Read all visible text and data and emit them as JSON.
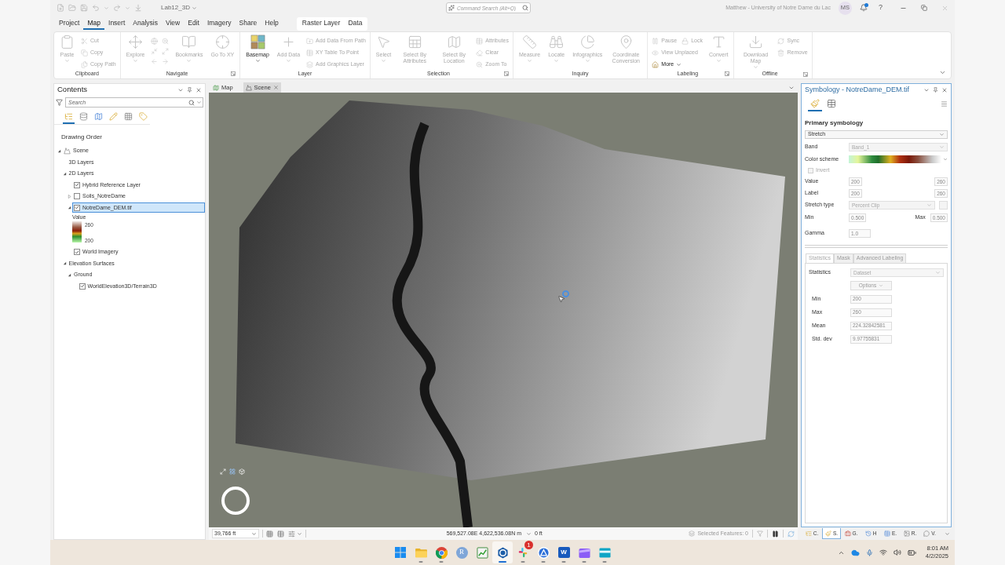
{
  "title_bar": {
    "project": "Lab12_3D",
    "search": {
      "placeholder": "Command Search (Alt+Q)"
    },
    "account": "Matthew - University of Notre Dame du Lac",
    "avatar": "MS",
    "notifications": true,
    "help": "?"
  },
  "menu_tabs": [
    {
      "label": "Project",
      "selected": false
    },
    {
      "label": "Map",
      "selected": true
    },
    {
      "label": "Insert",
      "selected": false
    },
    {
      "label": "Analysis",
      "selected": false
    },
    {
      "label": "View",
      "selected": false
    },
    {
      "label": "Edit",
      "selected": false
    },
    {
      "label": "Imagery",
      "selected": false
    },
    {
      "label": "Share",
      "selected": false
    },
    {
      "label": "Help",
      "selected": false
    }
  ],
  "contextual_tabs": [
    {
      "label": "Raster Layer",
      "selected": false
    },
    {
      "label": "Data",
      "selected": false
    }
  ],
  "ribbon": {
    "groups": [
      {
        "label": "Clipboard",
        "launcher": false,
        "items": [
          {
            "kind": "large",
            "label": "Paste",
            "disabled": true,
            "menu": true
          },
          {
            "kind": "stack",
            "rows": [
              [
                {
                  "label": "Cut",
                  "disabled": true,
                  "menu": false
                }
              ],
              [
                {
                  "label": "Copy",
                  "disabled": true,
                  "menu": false
                }
              ],
              [
                {
                  "label": "Copy Path",
                  "disabled": true,
                  "menu": false
                }
              ]
            ]
          }
        ]
      },
      {
        "label": "Navigate",
        "launcher": true,
        "items": [
          {
            "kind": "large",
            "label": "Explore",
            "disabled": true,
            "menu": true
          },
          {
            "kind": "tools",
            "disabled": true
          },
          {
            "kind": "large",
            "label": "Bookmarks",
            "disabled": true,
            "menu": true
          },
          {
            "kind": "large",
            "label": "Go To XY",
            "disabled": true,
            "menu": false
          }
        ]
      },
      {
        "label": "Layer",
        "launcher": false,
        "items": [
          {
            "kind": "large",
            "label": "Basemap",
            "disabled": false,
            "menu": true
          },
          {
            "kind": "large",
            "label": "Add Data",
            "disabled": true,
            "menu": true
          },
          {
            "kind": "stack",
            "rows": [
              [
                {
                  "label": "Add Data From Path",
                  "disabled": true,
                  "menu": false
                }
              ],
              [
                {
                  "label": "XY Table To Point",
                  "disabled": true,
                  "menu": false
                }
              ],
              [
                {
                  "label": "Add Graphics Layer",
                  "disabled": true,
                  "menu": false
                }
              ]
            ]
          }
        ]
      },
      {
        "label": "Selection",
        "launcher": true,
        "items": [
          {
            "kind": "large",
            "label": "Select",
            "disabled": true,
            "menu": true
          },
          {
            "kind": "large",
            "label": "Select By Attributes",
            "disabled": true,
            "menu": false
          },
          {
            "kind": "large",
            "label": "Select By Location",
            "disabled": true,
            "menu": false
          },
          {
            "kind": "stack",
            "rows": [
              [
                {
                  "label": "Attributes",
                  "disabled": true,
                  "menu": false
                }
              ],
              [
                {
                  "label": "Clear",
                  "disabled": true,
                  "menu": false
                }
              ],
              [
                {
                  "label": "Zoom To",
                  "disabled": true,
                  "menu": false
                }
              ]
            ]
          }
        ]
      },
      {
        "label": "Inquiry",
        "launcher": false,
        "items": [
          {
            "kind": "large",
            "label": "Measure",
            "disabled": true,
            "menu": true
          },
          {
            "kind": "large",
            "label": "Locate",
            "disabled": true,
            "menu": true
          },
          {
            "kind": "large",
            "label": "Infographics",
            "disabled": true,
            "menu": true
          },
          {
            "kind": "large",
            "label": "Coordinate Conversion",
            "disabled": true,
            "menu": false
          }
        ]
      },
      {
        "label": "Labeling",
        "launcher": true,
        "items": [
          {
            "kind": "stack",
            "rows": [
              [
                {
                  "label": "Pause",
                  "disabled": true,
                  "menu": false
                },
                {
                  "label": "Lock",
                  "disabled": true,
                  "menu": false
                }
              ],
              [
                {
                  "label": "View Unplaced",
                  "disabled": true,
                  "menu": false
                }
              ],
              [
                {
                  "label": "More",
                  "disabled": false,
                  "menu": true
                }
              ]
            ]
          },
          {
            "kind": "large",
            "label": "Convert",
            "disabled": true,
            "menu": true
          }
        ]
      },
      {
        "label": "Offline",
        "launcher": true,
        "items": [
          {
            "kind": "large",
            "label": "Download Map",
            "disabled": true,
            "menu": true
          },
          {
            "kind": "stack",
            "rows": [
              [
                {
                  "label": "Sync",
                  "disabled": true,
                  "menu": false
                }
              ],
              [
                {
                  "label": "Remove",
                  "disabled": true,
                  "menu": false
                }
              ]
            ]
          }
        ]
      }
    ]
  },
  "contents": {
    "title": "Contents",
    "search": {
      "placeholder": "Search"
    },
    "view_tabs": [
      {
        "selected": true
      },
      {
        "selected": false
      },
      {
        "selected": false
      },
      {
        "selected": false
      },
      {
        "selected": false
      },
      {
        "selected": false
      }
    ],
    "heading": "Drawing Order",
    "tree": [
      {
        "label": "Scene",
        "kind": "scene",
        "expanded": true,
        "selected": false,
        "children": [
          {
            "label": "3D Layers",
            "selected": false
          },
          {
            "label": "2D Layers",
            "expanded": true,
            "selected": false,
            "children": [
              {
                "label": "Hybrid Reference Layer",
                "checked": true,
                "selected": false
              },
              {
                "label": "Soils_NotreDame",
                "expanded": false,
                "checked": false,
                "selected": false
              },
              {
                "label": "NotreDame_DEM.tif",
                "expanded": true,
                "checked": true,
                "selected": true,
                "legend": {
                  "title": "Value",
                  "high": "260",
                  "low": "200"
                }
              },
              {
                "label": "World Imagery",
                "checked": true,
                "selected": false
              }
            ]
          },
          {
            "label": "Elevation Surfaces",
            "expanded": true,
            "selected": false,
            "children": [
              {
                "label": "Ground",
                "expanded": true,
                "selected": false,
                "children": [
                  {
                    "label": "WorldElevation3D/Terrain3D",
                    "checked": true,
                    "selected": false
                  }
                ]
              }
            ]
          }
        ]
      }
    ]
  },
  "map_view": {
    "tabs": [
      {
        "label": "Map",
        "kind": "map",
        "selected": false,
        "closable": false
      },
      {
        "label": "Scene",
        "kind": "scene",
        "selected": true,
        "closable": true
      }
    ]
  },
  "status_bar": {
    "scale": "39,766 ft",
    "coordinates": "569,527.08E 4,622,536.08N m",
    "elevation": "0 ft",
    "selected_features": "Selected Features: 0"
  },
  "symbology": {
    "title": "Symbology - NotreDame_DEM.tif",
    "tabs": [
      {
        "selected": true
      },
      {
        "selected": false
      }
    ],
    "heading": "Primary symbology",
    "renderer": "Stretch",
    "fields": [
      {
        "kind": "select",
        "label": "Band",
        "value": "Band_1",
        "disabled": true,
        "button": false
      },
      {
        "kind": "ramp",
        "label": "Color scheme"
      },
      {
        "kind": "checkbox",
        "label": "Invert",
        "checked": false,
        "disabled": true
      },
      {
        "kind": "range",
        "label": "Value",
        "low": "200",
        "high": "260"
      },
      {
        "kind": "range",
        "label": "Label",
        "low": "200",
        "high": "260"
      },
      {
        "kind": "select",
        "label": "Stretch type",
        "value": "Percent Clip",
        "disabled": true,
        "button": true
      },
      {
        "kind": "minmax",
        "label": "Min",
        "value": "0.500",
        "label_2": "Max",
        "value_2": "0.500"
      },
      {
        "kind": "input",
        "label": "Gamma",
        "value": "1.0"
      }
    ],
    "sub_tabs": [
      {
        "label": "Statistics",
        "selected": true
      },
      {
        "label": "Mask",
        "selected": false
      },
      {
        "label": "Advanced Labeling",
        "selected": false
      }
    ],
    "statistics": {
      "label": "Statistics",
      "source": "Dataset",
      "options": "Options",
      "rows": [
        {
          "label": "Min",
          "value": "200"
        },
        {
          "label": "Max",
          "value": "260"
        },
        {
          "label": "Mean",
          "value": "224.32842581"
        },
        {
          "label": "Std. dev",
          "value": "9.97755831"
        }
      ]
    }
  },
  "pane_tabs": [
    {
      "label": "C.",
      "selected": false
    },
    {
      "label": "S.",
      "selected": true
    },
    {
      "label": "G.",
      "selected": false
    },
    {
      "label": "H",
      "selected": false
    },
    {
      "label": "E.",
      "selected": false
    },
    {
      "label": "R.",
      "selected": false
    },
    {
      "label": "V.",
      "selected": false
    }
  ],
  "taskbar": {
    "apps": [
      {
        "kind": "start",
        "running": false,
        "selected": false
      },
      {
        "kind": "folder",
        "running": true,
        "selected": false
      },
      {
        "kind": "browser",
        "running": true,
        "selected": false
      },
      {
        "kind": "letter",
        "glyph": "R",
        "running": false,
        "selected": false
      },
      {
        "kind": "chart",
        "running": false,
        "selected": false
      },
      {
        "kind": "globe",
        "running": true,
        "selected": true
      },
      {
        "kind": "chat",
        "running": true,
        "selected": false,
        "badge": "1"
      },
      {
        "kind": "store",
        "running": true,
        "selected": false
      },
      {
        "kind": "document",
        "glyph": "W",
        "running": true,
        "selected": false
      },
      {
        "kind": "video",
        "running": true,
        "selected": false
      },
      {
        "kind": "window",
        "running": true,
        "selected": false
      }
    ],
    "time": "8:01 AM",
    "date": "4/2/2025"
  }
}
